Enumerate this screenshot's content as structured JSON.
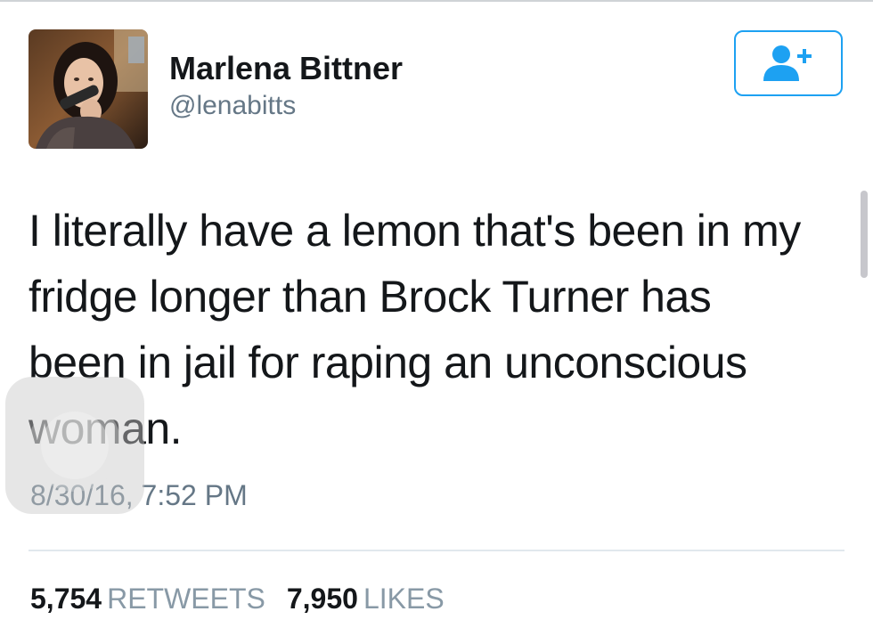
{
  "tweet": {
    "author": {
      "name": "Marlena Bittner",
      "handle": "@lenabitts"
    },
    "follow_button_icon": "add-user-icon",
    "text_lines": [
      "I literally have a lemon that's been in my",
      "fridge longer than Brock Turner has",
      "been in jail for raping an unconscious",
      "woman."
    ],
    "timestamp": "8/30/16, 7:52 PM",
    "stats": {
      "retweets_count": "5,754",
      "retweets_label": "RETWEETS",
      "likes_count": "7,950",
      "likes_label": "LIKES"
    }
  },
  "colors": {
    "accent": "#1da1f2",
    "secondary_text": "#657786",
    "stat_label": "#8899a6"
  }
}
